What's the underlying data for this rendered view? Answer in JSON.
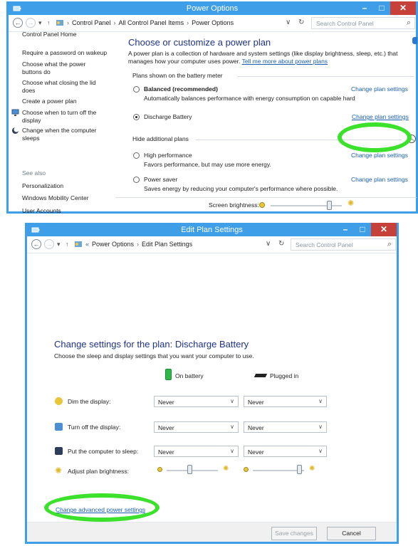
{
  "power_options": {
    "title": "Power Options",
    "address": {
      "crumbs": [
        "Control Panel",
        "All Control Panel Items",
        "Power Options"
      ],
      "search_placeholder": "Search Control Panel"
    },
    "sidebar": {
      "home": "Control Panel Home",
      "items": [
        "Require a password on wakeup",
        "Choose what the power buttons do",
        "Choose what closing the lid does",
        "Create a power plan",
        "Choose when to turn off the display",
        "Change when the computer sleeps"
      ],
      "see_also_heading": "See also",
      "see_also": [
        "Personalization",
        "Windows Mobility Center",
        "User Accounts"
      ]
    },
    "main": {
      "heading": "Choose or customize a power plan",
      "description": "A power plan is a collection of hardware and system settings (like display brightness, sleep, etc.) that manages how your computer uses power.",
      "learn_more": "Tell me more about power plans",
      "plans_section": "Plans shown on the battery meter",
      "plans": [
        {
          "name": "Balanced (recommended)",
          "desc": "Automatically balances performance with energy consumption on capable hard",
          "change": "Change plan settings",
          "selected": false
        },
        {
          "name": "Discharge Battery",
          "desc": "",
          "change": "Change plan settings",
          "selected": true
        }
      ],
      "hidden_section": "Hide additional plans",
      "hidden_plans": [
        {
          "name": "High performance",
          "desc": "Favors performance, but may use more energy.",
          "change": "Change plan settings"
        },
        {
          "name": "Power saver",
          "desc": "Saves energy by reducing your computer's performance where possible.",
          "change": "Change plan settings"
        }
      ],
      "brightness_label": "Screen brightness:",
      "brightness_level_pct": 82
    }
  },
  "edit_plan": {
    "title": "Edit Plan Settings",
    "address": {
      "crumbs": [
        "Power Options",
        "Edit Plan Settings"
      ],
      "search_placeholder": "Search Control Panel"
    },
    "heading": "Change settings for the plan: Discharge Battery",
    "subheading": "Choose the sleep and display settings that you want your computer to use.",
    "columns": {
      "battery": "On battery",
      "plugged": "Plugged in"
    },
    "rows": [
      {
        "label": "Dim the display:",
        "battery": "Never",
        "plugged": "Never"
      },
      {
        "label": "Turn off the display:",
        "battery": "Never",
        "plugged": "Never"
      },
      {
        "label": "Put the computer to sleep:",
        "battery": "Never",
        "plugged": "Never"
      }
    ],
    "brightness_label": "Adjust plan brightness:",
    "brightness_battery_pct": 45,
    "brightness_plugged_pct": 90,
    "advanced_link": "Change advanced power settings",
    "save_label": "Save changes",
    "cancel_label": "Cancel"
  },
  "colors": {
    "accent": "#3f9ee8",
    "link": "#1a5fb4",
    "highlight": "#3be12b",
    "close": "#c6413a"
  }
}
